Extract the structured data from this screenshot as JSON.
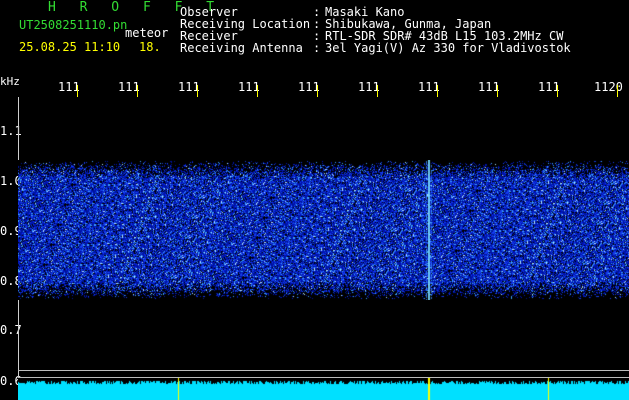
{
  "header": {
    "brand": "H R O F F T",
    "file_name": "UT2508251110.pn",
    "mode": "meteor",
    "datetime": "25.08.25 11:10",
    "level": "18."
  },
  "info": {
    "rows": [
      {
        "label": "Observer",
        "colon": ":",
        "value": "Masaki Kano"
      },
      {
        "label": "Receiving Location",
        "colon": ":",
        "value": "Shibukawa, Gunma, Japan"
      },
      {
        "label": "Receiver",
        "colon": ":",
        "value": "RTL-SDR SDR# 43dB L15 103.2MHz CW"
      },
      {
        "label": "Receiving Antenna",
        "colon": ":",
        "value": "3el Yagi(V) Az 330 for Vladivostok"
      }
    ]
  },
  "x_axis": {
    "ticks": [
      "111",
      "111",
      "111",
      "111",
      "111",
      "111",
      "111",
      "111",
      "111",
      "1120"
    ]
  },
  "y_axis": {
    "unit": "kHz",
    "ticks": [
      "1.1",
      "1.0",
      "0.9",
      "0.8",
      "0.7",
      "0.6"
    ]
  },
  "display": {
    "background_color": "#000000",
    "text_color": "#ffffff",
    "brand_color": "#33dd33",
    "tick_color": "#ffff00",
    "spectrogram_color": "#1a3cff",
    "signal_color": "#00e0ff"
  }
}
